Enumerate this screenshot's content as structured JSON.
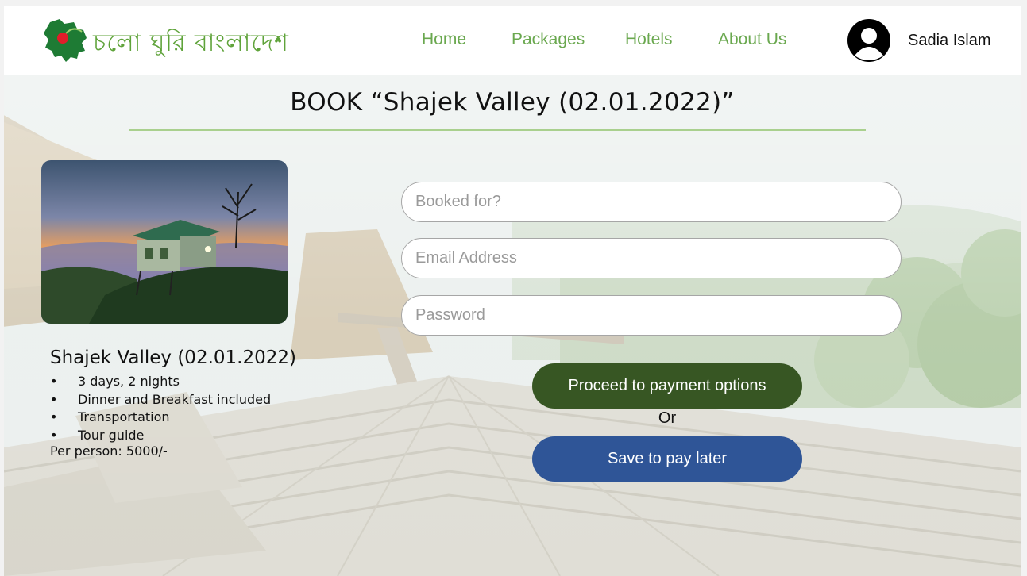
{
  "brand": {
    "name": "চলো ঘুরি বাংলাদেশ",
    "logo_icon": "bangladesh-map-flag-icon",
    "color": "#5fa33a"
  },
  "nav": {
    "items": [
      "Home",
      "Packages",
      "Hotels",
      "About Us"
    ],
    "color": "#6aa84f"
  },
  "user": {
    "name": "Sadia Islam",
    "avatar_icon": "user-avatar-icon"
  },
  "page": {
    "title": "BOOK “Shajek Valley (02.01.2022)”",
    "accent": "#a9d08e"
  },
  "package": {
    "name": "Shajek Valley (02.01.2022)",
    "bullet": "•",
    "features": [
      "3 days, 2 nights",
      "Dinner and Breakfast included",
      "Transportation",
      "Tour guide"
    ],
    "price": "Per person: 5000/-"
  },
  "form": {
    "booked_for_placeholder": "Booked for?",
    "email_placeholder": "Email Address",
    "password_placeholder": "Password"
  },
  "actions": {
    "proceed_label": "Proceed to payment options",
    "or_label": "Or",
    "save_label": "Save to pay later",
    "proceed_color": "#375623",
    "save_color": "#2f5597"
  }
}
